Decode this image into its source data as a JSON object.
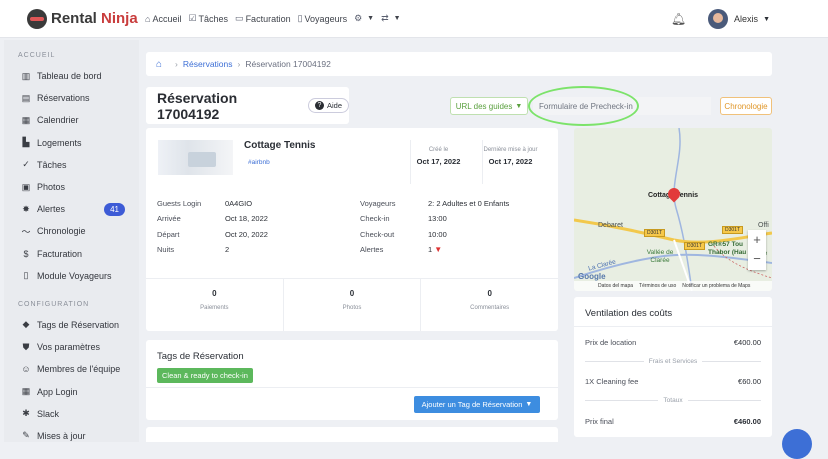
{
  "brand": {
    "part1": "Rental",
    "part2": "Ninja"
  },
  "nav": {
    "items": [
      {
        "icon": "home-icon",
        "glyph": "⌂",
        "label": "Accueil"
      },
      {
        "icon": "check-icon",
        "glyph": "☑",
        "label": "Tâches"
      },
      {
        "icon": "invoice-icon",
        "glyph": "▭",
        "label": "Facturation"
      },
      {
        "icon": "phone-icon",
        "glyph": "▯",
        "label": "Voyageurs"
      }
    ],
    "settings_glyph": "⚙",
    "translate_glyph": "⇄"
  },
  "user": {
    "name": "Alexis"
  },
  "sidebar": {
    "section1": "ACCUEIL",
    "items1": [
      {
        "label": "Tableau de bord",
        "glyph": "▥"
      },
      {
        "label": "Réservations",
        "glyph": "▤"
      },
      {
        "label": "Calendrier",
        "glyph": "▦"
      },
      {
        "label": "Logements",
        "glyph": "▙"
      },
      {
        "label": "Tâches",
        "glyph": "✓"
      },
      {
        "label": "Photos",
        "glyph": "▣"
      },
      {
        "label": "Alertes",
        "glyph": "✸",
        "badge": "41"
      },
      {
        "label": "Chronologie",
        "glyph": "〜"
      },
      {
        "label": "Facturation",
        "glyph": "$"
      },
      {
        "label": "Module Voyageurs",
        "glyph": "▯"
      }
    ],
    "section2": "CONFIGURATION",
    "items2": [
      {
        "label": "Tags de Réservation",
        "glyph": "◆"
      },
      {
        "label": "Vos paramètres",
        "glyph": "⛊"
      },
      {
        "label": "Membres de l'équipe",
        "glyph": "☺"
      },
      {
        "label": "App Login",
        "glyph": "▦"
      },
      {
        "label": "Slack",
        "glyph": "✱"
      },
      {
        "label": "Mises à jour",
        "glyph": "✎"
      }
    ]
  },
  "breadcrumb": {
    "link": "Réservations",
    "current": "Réservation 17004192"
  },
  "header": {
    "title": "Réservation 17004192",
    "help": "Aide",
    "url_guides": "URL des guides",
    "precheckin": "Formulaire de Precheck-in",
    "chronology": "Chronologie"
  },
  "reservation": {
    "property": "Cottage Tennis",
    "channel": "#airbnb",
    "created_label": "Créé le",
    "created": "Oct 17, 2022",
    "updated_label": "Dernière mise à jour",
    "updated": "Oct 17, 2022",
    "left": [
      {
        "label": "Guests Login",
        "value": "0A4GIO"
      },
      {
        "label": "Arrivée",
        "value": "Oct 18, 2022"
      },
      {
        "label": "Départ",
        "value": "Oct 20, 2022"
      },
      {
        "label": "Nuits",
        "value": "2"
      }
    ],
    "right": [
      {
        "label": "Voyageurs",
        "value": "2: 2 Adultes et 0 Enfants"
      },
      {
        "label": "Check-in",
        "value": "13:00"
      },
      {
        "label": "Check-out",
        "value": "10:00"
      },
      {
        "label": "Alertes",
        "value": "1"
      }
    ],
    "stats": [
      {
        "num": "0",
        "label": "Paiements"
      },
      {
        "num": "0",
        "label": "Photos"
      },
      {
        "num": "0",
        "label": "Commentaires"
      }
    ]
  },
  "tags": {
    "title": "Tags de Réservation",
    "tag": "Clean & ready to check-in",
    "add": "Ajouter un Tag de Réservation"
  },
  "map": {
    "place": "Cottage Tennis",
    "debaret": "Debaret",
    "road1": "D301T",
    "road2": "D301T",
    "road3": "D301T",
    "vallee": "Vallée de Clarée",
    "gr": "GR®57 Tou Thabor (Hau",
    "offi": "Offi",
    "river": "La Clarée",
    "pe": "pe",
    "google": "Google",
    "footer": [
      "Datos del mapa",
      "Términos de uso",
      "Notificar un problema de Maps"
    ]
  },
  "costs": {
    "title": "Ventilation des coûts",
    "location_label": "Prix de location",
    "location": "€400.00",
    "fees_divider": "Frais et Services",
    "cleaning_label": "1X Cleaning fee",
    "cleaning": "€60.00",
    "totals_divider": "Totaux",
    "final_label": "Prix final",
    "final": "€460.00"
  },
  "colors": {
    "accent": "#3d6fd6",
    "green": "#5cb85c",
    "highlight": "#7ce36a",
    "brand_red": "#c93d3d"
  }
}
